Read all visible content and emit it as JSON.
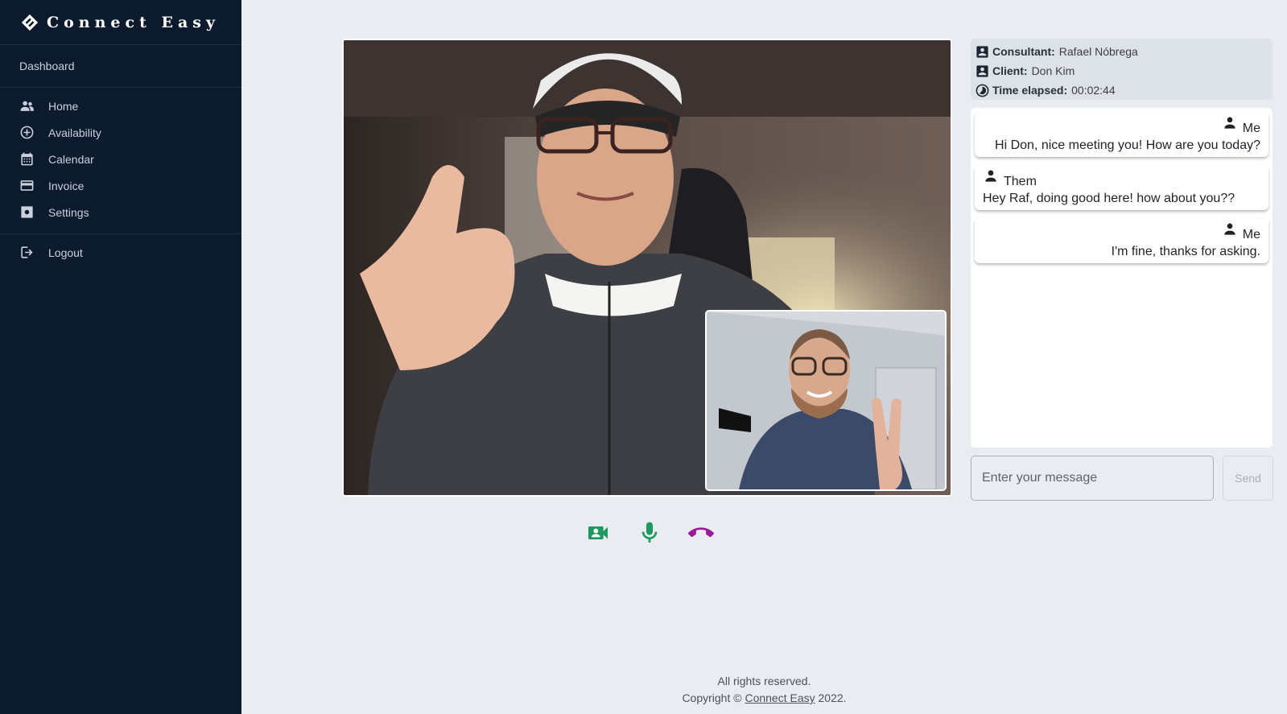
{
  "brand": {
    "name": "Connect Easy",
    "icon": "connect-easy-logo"
  },
  "sidebar": {
    "section_title": "Dashboard",
    "items": [
      {
        "label": "Home",
        "icon": "people-icon"
      },
      {
        "label": "Availability",
        "icon": "plus-circle-icon"
      },
      {
        "label": "Calendar",
        "icon": "calendar-icon"
      },
      {
        "label": "Invoice",
        "icon": "credit-card-icon"
      },
      {
        "label": "Settings",
        "icon": "gear-icon"
      }
    ],
    "logout": {
      "label": "Logout",
      "icon": "logout-icon"
    }
  },
  "call": {
    "controls": [
      {
        "name": "camera",
        "icon": "video-camera-icon",
        "color": "#1a9a5c"
      },
      {
        "name": "microphone",
        "icon": "microphone-icon",
        "color": "#1a9a5c"
      },
      {
        "name": "hang-up",
        "icon": "phone-hangup-icon",
        "color": "#9a1a9a"
      }
    ]
  },
  "info": {
    "consultant_label": "Consultant:",
    "consultant": "Rafael Nóbrega",
    "client_label": "Client:",
    "client": "Don Kim",
    "time_label": "Time elapsed:",
    "time": "00:02:44"
  },
  "chat": {
    "messages": [
      {
        "sender": "Me",
        "text": "Hi Don, nice meeting you! How are you today?"
      },
      {
        "sender": "Them",
        "text": "Hey Raf, doing good here! how about you??"
      },
      {
        "sender": "Me",
        "text": "I'm fine, thanks for asking."
      }
    ],
    "input_placeholder": "Enter your message",
    "send_label": "Send"
  },
  "footer": {
    "line1": "All rights reserved.",
    "copyright_prefix": "Copyright ©",
    "link": "Connect Easy",
    "year": "2022."
  },
  "colors": {
    "sidebar": "#0c1a2e",
    "background": "#e9edf1",
    "accent_green": "#1a9a5c",
    "hangup": "#9a1a9a"
  }
}
